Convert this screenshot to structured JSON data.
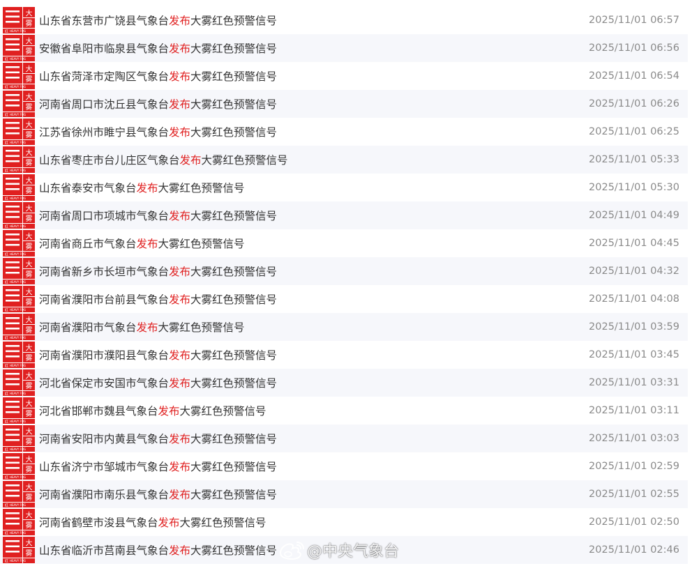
{
  "colors": {
    "icon_red": "#e02020",
    "keyword_red": "#e02020",
    "text": "#333333",
    "time": "#8a8a8a",
    "row_alt": "#f6f7fb"
  },
  "warning_icon": {
    "icon": "fog-red-warning-icon",
    "char_top": "大",
    "char_bottom": "雾",
    "label_cn": "红",
    "label_en": "HEAVY FOG"
  },
  "warnings": [
    {
      "prefix": "山东省东营市广饶县气象台",
      "keyword": "发布",
      "suffix": "大雾红色预警信号",
      "time": "2025/11/01 06:57"
    },
    {
      "prefix": "安徽省阜阳市临泉县气象台",
      "keyword": "发布",
      "suffix": "大雾红色预警信号",
      "time": "2025/11/01 06:56"
    },
    {
      "prefix": "山东省菏泽市定陶区气象台",
      "keyword": "发布",
      "suffix": "大雾红色预警信号",
      "time": "2025/11/01 06:54"
    },
    {
      "prefix": "河南省周口市沈丘县气象台",
      "keyword": "发布",
      "suffix": "大雾红色预警信号",
      "time": "2025/11/01 06:26"
    },
    {
      "prefix": "江苏省徐州市睢宁县气象台",
      "keyword": "发布",
      "suffix": "大雾红色预警信号",
      "time": "2025/11/01 06:25"
    },
    {
      "prefix": "山东省枣庄市台儿庄区气象台",
      "keyword": "发布",
      "suffix": "大雾红色预警信号",
      "time": "2025/11/01 05:33"
    },
    {
      "prefix": "山东省泰安市气象台",
      "keyword": "发布",
      "suffix": "大雾红色预警信号",
      "time": "2025/11/01 05:30"
    },
    {
      "prefix": "河南省周口市项城市气象台",
      "keyword": "发布",
      "suffix": "大雾红色预警信号",
      "time": "2025/11/01 04:49"
    },
    {
      "prefix": "河南省商丘市气象台",
      "keyword": "发布",
      "suffix": "大雾红色预警信号",
      "time": "2025/11/01 04:45"
    },
    {
      "prefix": "河南省新乡市长垣市气象台",
      "keyword": "发布",
      "suffix": "大雾红色预警信号",
      "time": "2025/11/01 04:32"
    },
    {
      "prefix": "河南省濮阳市台前县气象台",
      "keyword": "发布",
      "suffix": "大雾红色预警信号",
      "time": "2025/11/01 04:08"
    },
    {
      "prefix": "河南省濮阳市气象台",
      "keyword": "发布",
      "suffix": "大雾红色预警信号",
      "time": "2025/11/01 03:59"
    },
    {
      "prefix": "河南省濮阳市濮阳县气象台",
      "keyword": "发布",
      "suffix": "大雾红色预警信号",
      "time": "2025/11/01 03:45"
    },
    {
      "prefix": "河北省保定市安国市气象台",
      "keyword": "发布",
      "suffix": "大雾红色预警信号",
      "time": "2025/11/01 03:31"
    },
    {
      "prefix": "河北省邯郸市魏县气象台",
      "keyword": "发布",
      "suffix": "大雾红色预警信号",
      "time": "2025/11/01 03:11"
    },
    {
      "prefix": "河南省安阳市内黄县气象台",
      "keyword": "发布",
      "suffix": "大雾红色预警信号",
      "time": "2025/11/01 03:03"
    },
    {
      "prefix": "山东省济宁市邹城市气象台",
      "keyword": "发布",
      "suffix": "大雾红色预警信号",
      "time": "2025/11/01 02:59"
    },
    {
      "prefix": "河南省濮阳市南乐县气象台",
      "keyword": "发布",
      "suffix": "大雾红色预警信号",
      "time": "2025/11/01 02:55"
    },
    {
      "prefix": "河南省鹤壁市浚县气象台",
      "keyword": "发布",
      "suffix": "大雾红色预警信号",
      "time": "2025/11/01 02:50"
    },
    {
      "prefix": "山东省临沂市莒南县气象台",
      "keyword": "发布",
      "suffix": "大雾红色预警信号",
      "time": "2025/11/01 02:46"
    }
  ],
  "watermark": {
    "icon": "weibo-logo-icon",
    "text": "@中央气象台"
  }
}
